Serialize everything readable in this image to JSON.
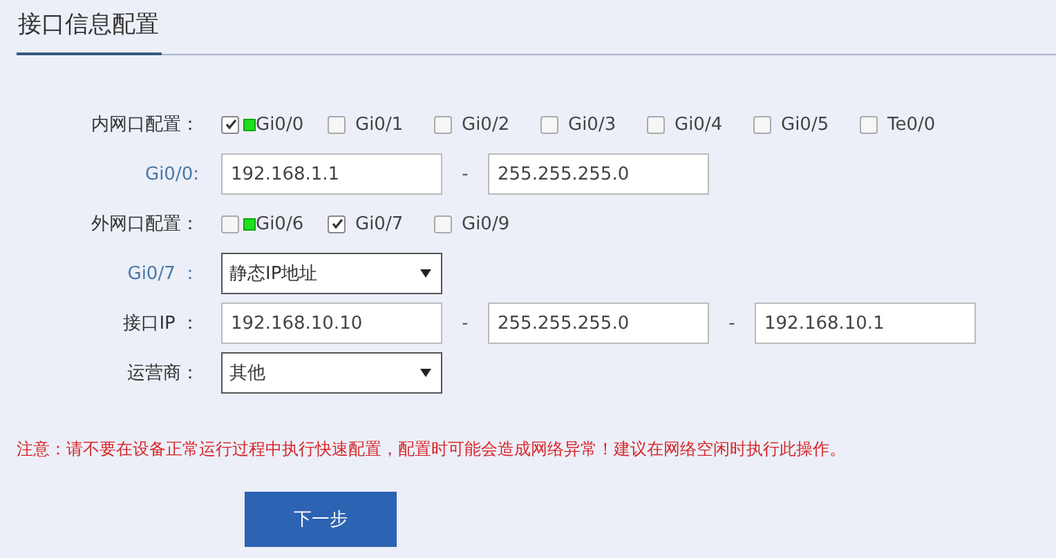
{
  "title": "接口信息配置",
  "rows": [
    {
      "kind": "ports",
      "label": "内网口配置：",
      "port_label": false,
      "ports": [
        {
          "name": "Gi0/0",
          "checked": true,
          "link_up": true
        },
        {
          "name": "Gi0/1",
          "checked": false,
          "link_up": false
        },
        {
          "name": "Gi0/2",
          "checked": false,
          "link_up": false
        },
        {
          "name": "Gi0/3",
          "checked": false,
          "link_up": false
        },
        {
          "name": "Gi0/4",
          "checked": false,
          "link_up": false
        },
        {
          "name": "Gi0/5",
          "checked": false,
          "link_up": false
        },
        {
          "name": "Te0/0",
          "checked": false,
          "link_up": false
        }
      ]
    },
    {
      "kind": "fields",
      "label": "Gi0/0:",
      "port_label": true,
      "values": [
        "192.168.1.1",
        "255.255.255.0"
      ],
      "separator": "-"
    },
    {
      "kind": "ports",
      "label": "外网口配置：",
      "port_label": false,
      "ports": [
        {
          "name": "Gi0/6",
          "checked": false,
          "link_up": true
        },
        {
          "name": "Gi0/7",
          "checked": true,
          "link_up": false
        },
        {
          "name": "Gi0/9",
          "checked": false,
          "link_up": false
        }
      ]
    },
    {
      "kind": "select",
      "label": "Gi0/7 ：",
      "port_label": true,
      "value": "静态IP地址"
    },
    {
      "kind": "fields",
      "label": "接口IP ：",
      "port_label": false,
      "values": [
        "192.168.10.10",
        "255.255.255.0",
        "192.168.10.1"
      ],
      "separator": "-"
    },
    {
      "kind": "select",
      "label": "运营商：",
      "port_label": false,
      "value": "其他"
    }
  ],
  "warning": "注意：请不要在设备正常运行过程中执行快速配置，配置时可能会造成网络异常！建议在网络空闲时执行此操作。",
  "next_button": "下一步"
}
